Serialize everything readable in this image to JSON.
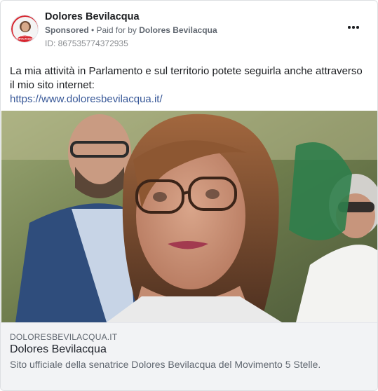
{
  "post": {
    "page_name": "Dolores Bevilacqua",
    "sponsored_label": "Sponsored",
    "paid_for_prefix": " • Paid for by ",
    "paid_for_name": "Dolores Bevilacqua",
    "ad_id": "ID: 867535774372935",
    "avatar_text_1": "DOLORES",
    "avatar_text_2": "BEVILACQUA",
    "body_text": "La mia attività in Parlamento e sul territorio potete seguirla anche attraverso il mio sito internet:",
    "body_link": "https://www.doloresbevilacqua.it/"
  },
  "link_preview": {
    "domain": "DOLORESBEVILACQUA.IT",
    "title": "Dolores Bevilacqua",
    "description": "Sito ufficiale della senatrice Dolores Bevilacqua del Movimento 5 Stelle."
  },
  "icons": {
    "more": "more-horizontal-icon"
  },
  "colors": {
    "link": "#385898",
    "avatar_accent": "#d7262f",
    "preview_bg": "#f2f3f5"
  }
}
